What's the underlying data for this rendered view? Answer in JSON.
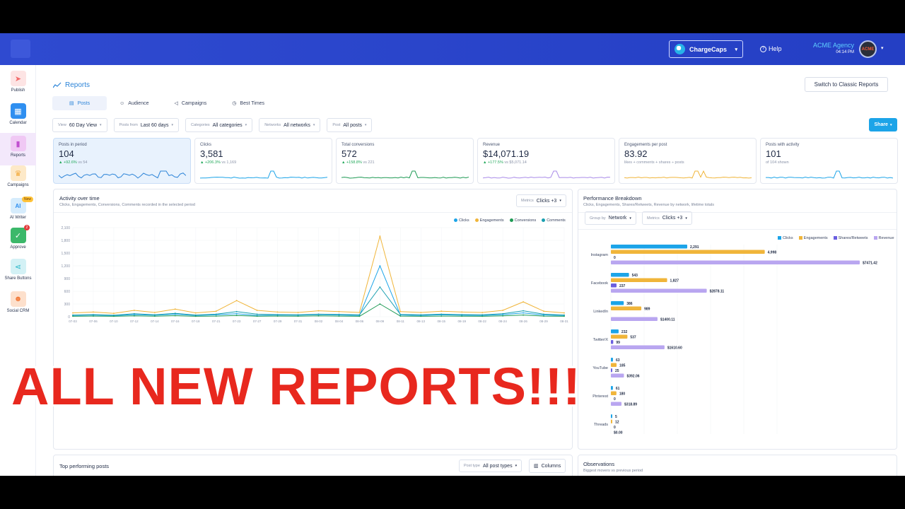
{
  "topbar": {
    "brand_select": "ChargeCaps",
    "help": "Help",
    "account_name": "ACME Agency",
    "account_time": "04:14 PM",
    "avatar_text": "ACME"
  },
  "sidebar": {
    "items": [
      {
        "label": "Publish",
        "color": "#f26a6a"
      },
      {
        "label": "Calendar",
        "color": "#2f8ff0"
      },
      {
        "label": "Reports",
        "color": "#d46be0"
      },
      {
        "label": "Campaigns",
        "color": "#f2a93a"
      },
      {
        "label": "AI Writer",
        "color": "#3aa7f0",
        "badge": "New"
      },
      {
        "label": "Approve",
        "color": "#3cb86a",
        "badge": "2"
      },
      {
        "label": "Share Buttons",
        "color": "#26b6c8"
      },
      {
        "label": "Social CRM",
        "color": "#f27a3a"
      }
    ]
  },
  "page": {
    "title": "Reports",
    "classic_button": "Switch to Classic Reports",
    "share_button": "Share"
  },
  "tabs": [
    "Posts",
    "Audience",
    "Campaigns",
    "Best Times"
  ],
  "filters": [
    {
      "label": "View",
      "value": "60 Day View"
    },
    {
      "label": "Posts from",
      "value": "Last 60 days"
    },
    {
      "label": "Categories",
      "value": "All categories"
    },
    {
      "label": "Networks",
      "value": "All networks"
    },
    {
      "label": "Post",
      "value": "All posts"
    }
  ],
  "kpis": [
    {
      "title": "Posts in period",
      "value": "104",
      "change": "▲ +92.6%",
      "vs": "vs 54",
      "color": "#2c84d8"
    },
    {
      "title": "Clicks",
      "value": "3,581",
      "change": "▲ +206.3%",
      "vs": "vs 1,169",
      "color": "#1ca4e8"
    },
    {
      "title": "Total conversions",
      "value": "572",
      "change": "▲ +158.8%",
      "vs": "vs 221",
      "color": "#1e9a54"
    },
    {
      "title": "Revenue",
      "value": "$14,071.19",
      "change": "▲ +177.5%",
      "vs": "vs $5,071.14",
      "color": "#a98be8"
    },
    {
      "title": "Engagements per post",
      "value": "83.92",
      "change": "",
      "vs": "likes + comments + shares ÷ posts",
      "color": "#f0b53a"
    },
    {
      "title": "Posts with activity",
      "value": "101",
      "change": "",
      "vs": "of 104 shown",
      "color": "#1ca4e8"
    }
  ],
  "activity": {
    "title": "Activity over time",
    "subtitle": "Clicks, Engagements, Conversions, Comments recorded in the selected period",
    "metrics_label": "Metrics",
    "metrics_value": "Clicks +3"
  },
  "breakdown": {
    "title": "Performance Breakdown",
    "subtitle": "Clicks, Engagements, Shares/Retweets, Revenue by network, lifetime totals",
    "group_label": "Group by",
    "group_value": "Network",
    "metrics_label": "Metrics",
    "metrics_value": "Clicks +3"
  },
  "top_posts": {
    "title": "Top performing posts",
    "post_type_label": "Post type",
    "post_type_value": "All post types",
    "columns_button": "Columns"
  },
  "observations": {
    "title": "Observations",
    "subtitle": "Biggest movers vs previous period"
  },
  "overlay_text": "ALL NEW REPORTS!!!",
  "chart_data": [
    {
      "type": "line",
      "legend": [
        "Clicks",
        "Engagements",
        "Conversions",
        "Comments"
      ],
      "colors": [
        "#1ca4e8",
        "#f0b53a",
        "#1e9a54",
        "#1a9fb0"
      ],
      "x": [
        "07-03",
        "07-06",
        "07-10",
        "07-12",
        "07-14",
        "07-16",
        "07-18",
        "07-21",
        "07-23",
        "07-27",
        "07-29",
        "07-31",
        "08-02",
        "08-04",
        "08-06",
        "08-09",
        "08-11",
        "08-13",
        "08-15",
        "08-19",
        "08-22",
        "08-24",
        "08-26",
        "08-29",
        "08-31"
      ],
      "yticks": [
        "2,100",
        "1,800",
        "1,500",
        "1,200",
        "900",
        "600",
        "300",
        "0"
      ],
      "ylim": [
        0,
        2100
      ],
      "series": [
        {
          "name": "Clicks",
          "values": [
            30,
            40,
            25,
            50,
            35,
            60,
            30,
            45,
            70,
            30,
            40,
            35,
            50,
            40,
            30,
            1200,
            40,
            30,
            45,
            35,
            30,
            50,
            90,
            40,
            30
          ]
        },
        {
          "name": "Engagements",
          "values": [
            90,
            110,
            80,
            150,
            100,
            180,
            90,
            130,
            380,
            150,
            110,
            100,
            140,
            120,
            100,
            1900,
            120,
            100,
            130,
            110,
            100,
            150,
            350,
            130,
            90
          ]
        },
        {
          "name": "Conversions",
          "values": [
            10,
            15,
            10,
            20,
            12,
            25,
            10,
            15,
            30,
            12,
            15,
            12,
            20,
            15,
            10,
            300,
            15,
            10,
            15,
            12,
            10,
            20,
            40,
            15,
            10
          ]
        },
        {
          "name": "Comments",
          "values": [
            40,
            50,
            35,
            70,
            45,
            80,
            40,
            60,
            120,
            60,
            50,
            45,
            60,
            55,
            45,
            700,
            55,
            45,
            60,
            50,
            45,
            70,
            140,
            60,
            40
          ]
        }
      ]
    },
    {
      "type": "bar",
      "legend": [
        "Clicks",
        "Engagements",
        "Shares/Retweets",
        "Revenue"
      ],
      "colors": [
        "#1ca4e8",
        "#f0b53a",
        "#6b5fe0",
        "#b9a6f0"
      ],
      "categories": [
        "Instagram",
        "Facebook",
        "LinkedIn",
        "Twitter/X",
        "YouTube",
        "Pinterest",
        "Threads"
      ],
      "series": [
        {
          "name": "Clicks",
          "values": [
            2291,
            543,
            386,
            232,
            63,
            61,
            5
          ],
          "labels": [
            "2,291",
            "543",
            "386",
            "232",
            "63",
            "61",
            "5"
          ]
        },
        {
          "name": "Engagements",
          "values": [
            4998,
            1827,
            989,
            537,
            185,
            180,
            12
          ],
          "labels": [
            "4,998",
            "1,827",
            "989",
            "537",
            "185",
            "180",
            "12"
          ]
        },
        {
          "name": "Shares/Retweets",
          "values": [
            0,
            237,
            0,
            99,
            25,
            0,
            0
          ],
          "labels": [
            "0",
            "237",
            "",
            "99",
            "25",
            "0",
            "0"
          ]
        },
        {
          "name": "Revenue",
          "values": [
            7471.42,
            2878.11,
            1400.11,
            1610.6,
            392.06,
            318.89,
            0
          ],
          "labels": [
            "$7471.42",
            "$2878.11",
            "$1400.11",
            "$1610.60",
            "$392.06",
            "$318.89",
            "$0.00"
          ]
        }
      ]
    }
  ]
}
